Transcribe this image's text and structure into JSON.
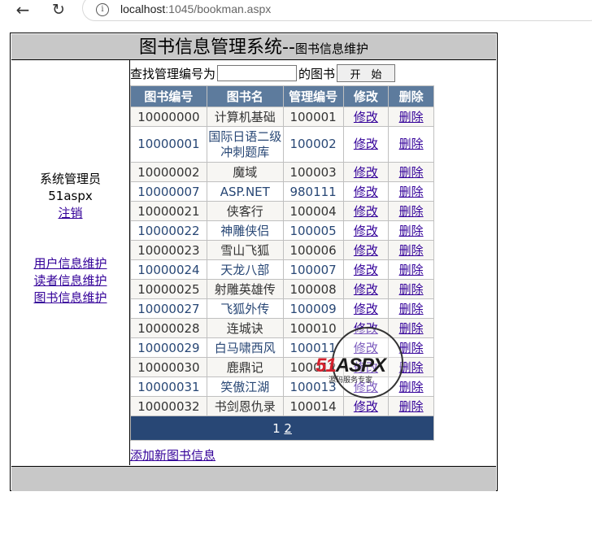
{
  "browser": {
    "url_host": "localhost",
    "url_rest": ":1045/bookman.aspx"
  },
  "header": {
    "title": "图书信息管理系统",
    "separator": "--",
    "subtitle": "图书信息维护"
  },
  "sidebar": {
    "role": "系统管理员",
    "username": "51aspx",
    "logout": "注销",
    "menu": [
      {
        "label": "用户信息维护"
      },
      {
        "label": "读者信息维护"
      },
      {
        "label": "图书信息维护"
      }
    ]
  },
  "search": {
    "prefix": "查找管理编号为",
    "value": "",
    "suffix": "的图书",
    "button": "开　始"
  },
  "table": {
    "columns": [
      "图书编号",
      "图书名",
      "管理编号",
      "修改",
      "删除"
    ],
    "edit_label": "修改",
    "delete_label": "删除",
    "rows": [
      {
        "id": "10000000",
        "name": "计算机基础",
        "code": "100001"
      },
      {
        "id": "10000001",
        "name": "国际日语二级冲刺题库",
        "code": "100002"
      },
      {
        "id": "10000002",
        "name": "魔域",
        "code": "100003"
      },
      {
        "id": "10000007",
        "name": "ASP.NET",
        "code": "980111"
      },
      {
        "id": "10000021",
        "name": "侠客行",
        "code": "100004"
      },
      {
        "id": "10000022",
        "name": "神雕侠侣",
        "code": "100005"
      },
      {
        "id": "10000023",
        "name": "雪山飞狐",
        "code": "100006"
      },
      {
        "id": "10000024",
        "name": "天龙八部",
        "code": "100007"
      },
      {
        "id": "10000025",
        "name": "射雕英雄传",
        "code": "100008"
      },
      {
        "id": "10000027",
        "name": "飞狐外传",
        "code": "100009"
      },
      {
        "id": "10000028",
        "name": "连城诀",
        "code": "100010"
      },
      {
        "id": "10000029",
        "name": "白马啸西风",
        "code": "100011"
      },
      {
        "id": "10000030",
        "name": "鹿鼎记",
        "code": "100012"
      },
      {
        "id": "10000031",
        "name": "笑傲江湖",
        "code": "100013"
      },
      {
        "id": "10000032",
        "name": "书剑恩仇录",
        "code": "100014"
      }
    ],
    "pager": {
      "current": "1",
      "next": "2"
    }
  },
  "add_link": "添加新图书信息",
  "watermark": {
    "brand_red": "51",
    "brand_dark": "ASPX",
    "tagline": "源码服务专家"
  },
  "colors": {
    "header_bg": "#c8c8c8",
    "grid_header": "#5d7b9d",
    "grid_pager": "#284775",
    "row_odd": "#f7f6f3",
    "link": "#330099"
  }
}
